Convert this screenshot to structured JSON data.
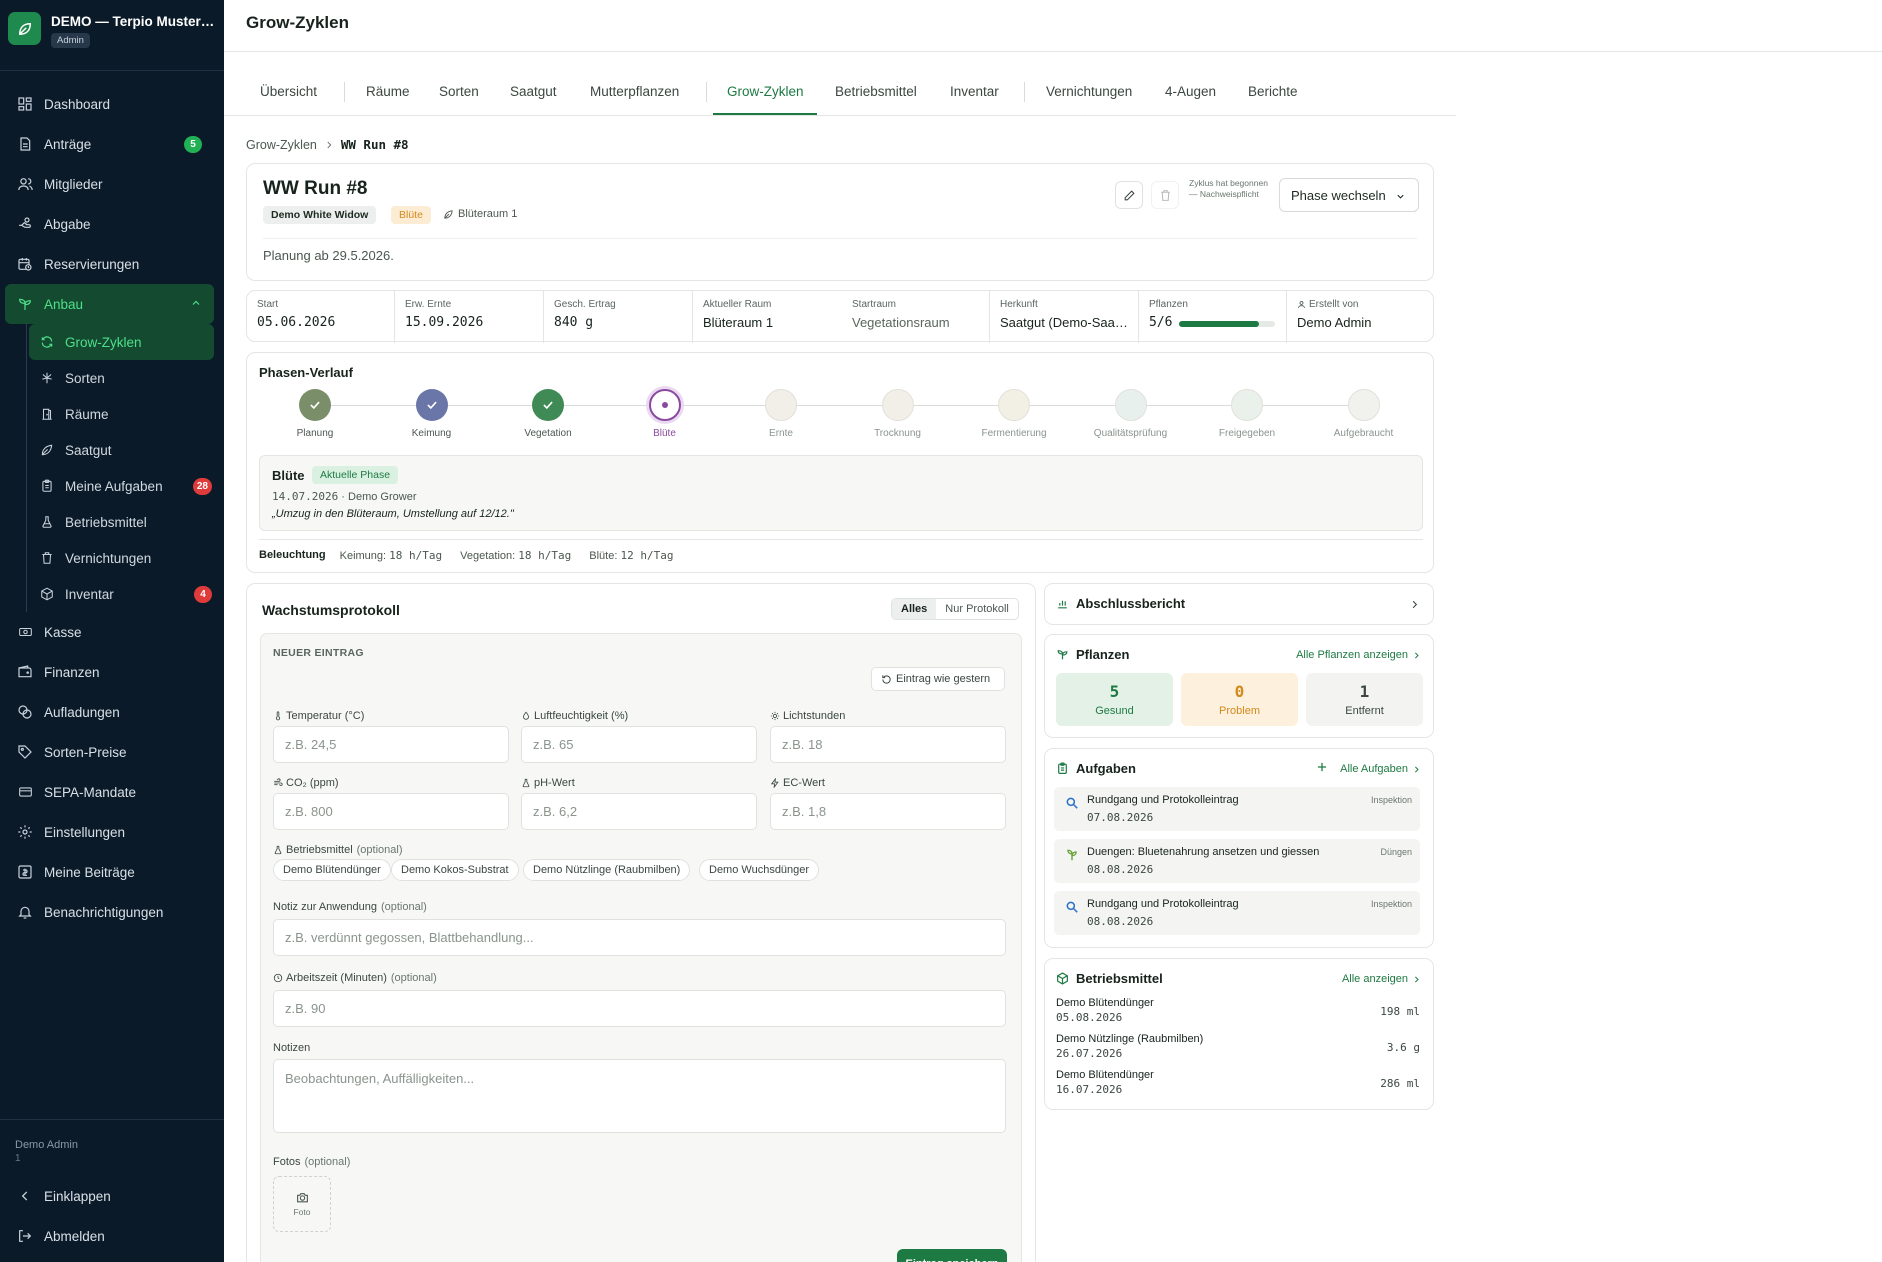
{
  "brand": {
    "title": "DEMO — Terpio Musterverein",
    "badge": "Admin"
  },
  "sidebar": {
    "items": [
      {
        "label": "Dashboard",
        "icon": "dashboard-icon"
      },
      {
        "label": "Anträge",
        "icon": "document-icon",
        "badge": "5"
      },
      {
        "label": "Mitglieder",
        "icon": "users-icon"
      },
      {
        "label": "Abgabe",
        "icon": "hand-icon"
      },
      {
        "label": "Reservierungen",
        "icon": "calendar-clock-icon"
      },
      {
        "label": "Anbau",
        "icon": "sprout-icon"
      }
    ],
    "subitems": [
      {
        "label": "Grow-Zyklen",
        "icon": "refresh-icon"
      },
      {
        "label": "Sorten",
        "icon": "leaf-icon"
      },
      {
        "label": "Räume",
        "icon": "door-icon"
      },
      {
        "label": "Saatgut",
        "icon": "seed-icon"
      },
      {
        "label": "Meine Aufgaben",
        "icon": "clipboard-icon",
        "badge": "28"
      },
      {
        "label": "Betriebsmittel",
        "icon": "flask-icon"
      },
      {
        "label": "Vernichtungen",
        "icon": "trash-icon"
      },
      {
        "label": "Inventar",
        "icon": "box-icon",
        "badge": "4"
      }
    ],
    "items2": [
      {
        "label": "Kasse",
        "icon": "cash-icon"
      },
      {
        "label": "Finanzen",
        "icon": "wallet-icon"
      },
      {
        "label": "Aufladungen",
        "icon": "coins-icon"
      },
      {
        "label": "Sorten-Preise",
        "icon": "tag-icon"
      },
      {
        "label": "SEPA-Mandate",
        "icon": "card-icon"
      },
      {
        "label": "Einstellungen",
        "icon": "gear-icon"
      },
      {
        "label": "Meine Beiträge",
        "icon": "receipt-icon"
      },
      {
        "label": "Benachrichtigungen",
        "icon": "bell-icon"
      }
    ],
    "user_name": "Demo Admin",
    "user_sub": "1",
    "collapse_label": "Einklappen",
    "logout_label": "Abmelden"
  },
  "header": {
    "title": "Grow-Zyklen"
  },
  "tabs": [
    "Übersicht",
    "Räume",
    "Sorten",
    "Saatgut",
    "Mutterpflanzen",
    "Grow-Zyklen",
    "Betriebsmittel",
    "Inventar",
    "Vernichtungen",
    "4-Augen",
    "Berichte"
  ],
  "breadcrumb": {
    "parent": "Grow-Zyklen",
    "current": "WW Run #8"
  },
  "run": {
    "title": "WW Run #8",
    "strain": "Demo White Widow",
    "phase": "Blüte",
    "room": "Blüteraum 1",
    "plan_text": "Planung ab 29.5.2026.",
    "locked_note": "Zyklus hat begonnen — Nachweispflicht",
    "phase_button": "Phase wechseln"
  },
  "stats": [
    {
      "label": "Start",
      "value": "05.06.2026",
      "mono": true
    },
    {
      "label": "Erw. Ernte",
      "value": "15.09.2026",
      "mono": true
    },
    {
      "label": "Gesch. Ertrag",
      "value": "840 g",
      "mono": true
    },
    {
      "label": "Aktueller Raum",
      "value": "Blüteraum 1"
    },
    {
      "label": "Startraum",
      "value": "Vegetationsraum"
    },
    {
      "label": "Herkunft",
      "value": "Saatgut (Demo-Saatgut White Widow)"
    },
    {
      "label": "Pflanzen",
      "value": "5/6",
      "progress": 0.8333
    },
    {
      "label": "Erstellt von",
      "value": "Demo Admin"
    }
  ],
  "timeline": {
    "title": "Phasen-Verlauf",
    "steps": [
      {
        "label": "Planung",
        "state": "done",
        "color": "#7b8e6a"
      },
      {
        "label": "Keimung",
        "state": "done",
        "color": "#6a76a8"
      },
      {
        "label": "Vegetation",
        "state": "done",
        "color": "#3f8a55"
      },
      {
        "label": "Blüte",
        "state": "current",
        "color": "#8a4aa0"
      },
      {
        "label": "Ernte",
        "state": "future",
        "color": "#f2eee8"
      },
      {
        "label": "Trocknung",
        "state": "future",
        "color": "#f2efe8"
      },
      {
        "label": "Fermentierung",
        "state": "future",
        "color": "#f2efe4"
      },
      {
        "label": "Qualitätsprüfung",
        "state": "future",
        "color": "#e8f0ee"
      },
      {
        "label": "Freigegeben",
        "state": "future",
        "color": "#e9f1ea"
      },
      {
        "label": "Aufgebraucht",
        "state": "future",
        "color": "#f1f1ee"
      }
    ],
    "current_title": "Blüte",
    "current_tag": "Aktuelle Phase",
    "current_date": "14.07.2026",
    "current_meta": "· Demo Grower",
    "current_quote": "„Umzug in den Blüteraum, Umstellung auf 12/12.\""
  },
  "lighting": {
    "label": "Beleuchtung",
    "items": [
      {
        "phase": "Keimung:",
        "value": "18 h/Tag"
      },
      {
        "phase": "Vegetation:",
        "value": "18 h/Tag"
      },
      {
        "phase": "Blüte:",
        "value": "12 h/Tag"
      }
    ]
  },
  "log": {
    "title": "Wachstumsprotokoll",
    "filter_all": "Alles",
    "filter_protocol": "Nur Protokoll",
    "new_entry": "NEUER EINTRAG",
    "copy_button": "Eintrag wie gestern",
    "fields": [
      {
        "label": "Temperatur (°C)",
        "placeholder": "z.B. 24,5",
        "icon": "thermometer-icon"
      },
      {
        "label": "Luftfeuchtigkeit (%)",
        "placeholder": "z.B. 65",
        "icon": "droplet-icon"
      },
      {
        "label": "Lichtstunden",
        "placeholder": "z.B. 18",
        "icon": "sun-icon"
      },
      {
        "label": "CO₂ (ppm)",
        "placeholder": "z.B. 800",
        "icon": "wind-icon"
      },
      {
        "label": "pH-Wert",
        "placeholder": "z.B. 6,2",
        "icon": "flask-icon"
      },
      {
        "label": "EC-Wert",
        "placeholder": "z.B. 1,8",
        "icon": "bolt-icon"
      }
    ],
    "resources_label": "Betriebsmittel",
    "optional": "(optional)",
    "chips": [
      "Demo Blütendünger",
      "Demo Kokos-Substrat",
      "Demo Nützlinge (Raubmilben)",
      "Demo Wuchsdünger"
    ],
    "note_label": "Notiz zur Anwendung",
    "note_placeholder": "z.B. verdünnt gegossen, Blattbehandlung...",
    "worktime_label": "Arbeitszeit (Minuten)",
    "worktime_placeholder": "z.B. 90",
    "notes_label": "Notizen",
    "notes_placeholder": "Beobachtungen, Auffälligkeiten...",
    "photos_label": "Fotos",
    "photo_button": "Foto",
    "save_button": "Eintrag speichern"
  },
  "report": {
    "title": "Abschlussbericht"
  },
  "plants": {
    "title": "Pflanzen",
    "link": "Alle Pflanzen anzeigen",
    "healthy": {
      "count": "5",
      "label": "Gesund"
    },
    "problem": {
      "count": "0",
      "label": "Problem"
    },
    "removed": {
      "count": "1",
      "label": "Entfernt"
    }
  },
  "tasks": {
    "title": "Aufgaben",
    "link": "Alle Aufgaben",
    "items": [
      {
        "title": "Rundgang und Protokolleintrag",
        "date": "07.08.2026",
        "kind": "Inspektion",
        "icon": "magnifier-icon"
      },
      {
        "title": "Duengen: Bluetenahrung ansetzen und giessen",
        "date": "08.08.2026",
        "kind": "Düngen",
        "icon": "plant-icon"
      },
      {
        "title": "Rundgang und Protokolleintrag",
        "date": "08.08.2026",
        "kind": "Inspektion",
        "icon": "magnifier-icon"
      }
    ]
  },
  "resources": {
    "title": "Betriebsmittel",
    "link": "Alle anzeigen",
    "items": [
      {
        "name": "Demo Blütendünger",
        "date": "05.08.2026",
        "qty": "198 ml"
      },
      {
        "name": "Demo Nützlinge (Raubmilben)",
        "date": "26.07.2026",
        "qty": "3.6 g"
      },
      {
        "name": "Demo Blütendünger",
        "date": "16.07.2026",
        "qty": "286 ml"
      }
    ]
  }
}
